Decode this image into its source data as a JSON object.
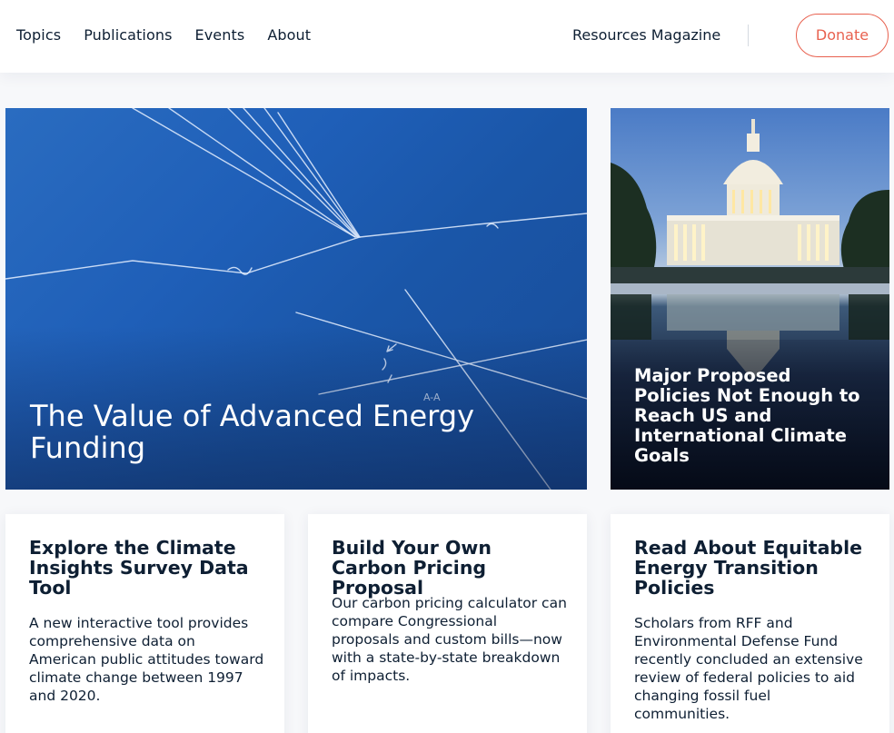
{
  "header": {
    "nav": [
      {
        "label": "Topics"
      },
      {
        "label": "Publications"
      },
      {
        "label": "Events"
      },
      {
        "label": "About"
      }
    ],
    "magazine_label": "Resources Magazine",
    "donate_label": "Donate"
  },
  "hero": {
    "main_title": "The Value of Advanced Energy Funding",
    "side_title": "Major Proposed Policies Not Enough to Reach US and International Climate Goals"
  },
  "cards": [
    {
      "title": "Explore the Climate Insights Survey Data Tool",
      "body": "A new interactive tool provides comprehensive data on American public attitudes toward climate change between 1997 and 2020."
    },
    {
      "title": "Build Your Own Carbon Pricing Proposal",
      "body": "Our carbon pricing calculator can compare Congressional proposals and custom bills—now with a state-by-state breakdown of impacts."
    },
    {
      "title": "Read About Equitable Energy Transition Policies",
      "body": "Scholars from RFF and Environmental Defense Fund recently concluded an extensive review of federal policies to aid changing fossil fuel communities."
    }
  ],
  "colors": {
    "accent": "#e8614f",
    "text": "#0e1f33",
    "blueprint": "#1f5fb8"
  }
}
